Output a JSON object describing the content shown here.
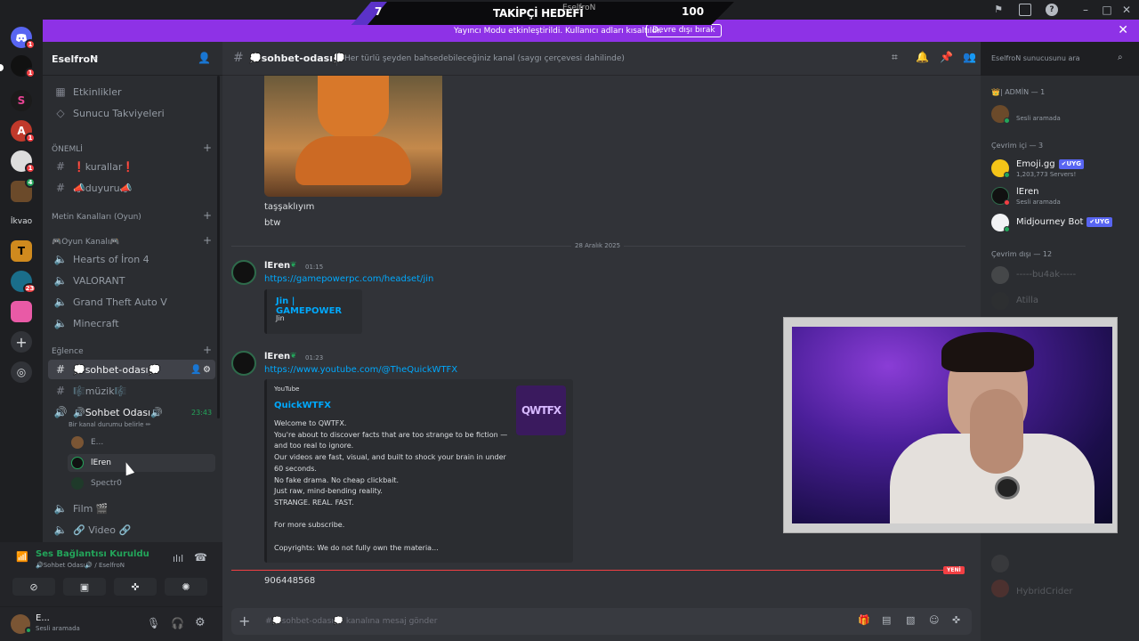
{
  "overlay": {
    "goal_current": "7",
    "goal_title": "TAKİPÇİ HEDEFİ",
    "goal_target": "100",
    "goal_user": "EselfroN"
  },
  "notice": {
    "text": "Yayıncı Modu etkinleştirildi. Kullanıcı adları kısaltıldı.",
    "button": "Devre dışı bırak"
  },
  "rail": {
    "servers": [
      {
        "label": "",
        "badge": "1",
        "color": "#5865f2"
      },
      {
        "label": "",
        "badge": "1",
        "color": "#111111"
      },
      {
        "label": "S",
        "badge": "",
        "color": "#1b1b1b"
      },
      {
        "label": "A",
        "badge": "1",
        "color": "#c0392b"
      },
      {
        "label": "",
        "badge": "1",
        "color": "#dddddd"
      },
      {
        "label": "",
        "badge": "4",
        "color": "#6b4a2a"
      },
      {
        "label": "İkvao",
        "badge": "",
        "color": "#1e1f22"
      },
      {
        "label": "T",
        "badge": "",
        "color": "#d08a1e"
      },
      {
        "label": "",
        "badge": "23",
        "color": "#1a6e8a"
      },
      {
        "label": "",
        "badge": "",
        "color": "#e95aa6"
      }
    ]
  },
  "sidebar": {
    "server_name": "EselfroN",
    "top_items": [
      "Etkinlikler",
      "Sunucu Takviyeleri"
    ],
    "categories": {
      "onemli": "ÖNEMLİ",
      "metin": "Metin Kanalları (Oyun)",
      "oyun": "🎮Oyun Kanalı🎮",
      "eglence": "Eğlence"
    },
    "channels": {
      "kurallar": "❗kurallar❗",
      "duyuru": "📣duyuru📣",
      "hoi": "Hearts of İron 4",
      "valorant": "VALORANT",
      "gta": "Grand Theft Auto V",
      "minecraft": "Minecraft",
      "sohbet": "💭sohbet-odası💭",
      "muzik": "🎼müzik🎼",
      "sohbet_voice": "🔊Sohbet Odası🔊",
      "sohbet_voice_time": "23:43",
      "voice_status": "Bir kanal durumu belirle ✏",
      "film": "Film 🎬",
      "video": "🔗 Video 🔗"
    },
    "voice_users": [
      "E...",
      "lEren",
      "Spectr0"
    ]
  },
  "voice_panel": {
    "status": "Ses Bağlantısı Kuruldu",
    "channel": "🔊Sohbet Odası🔊 / EselfroN"
  },
  "user_panel": {
    "name": "E...",
    "status": "Sesli aramada"
  },
  "chat": {
    "channel": "💭sohbet-odası💭",
    "topic": "Her türlü şeyden bahsedebileceğiniz kanal (saygı çerçevesi dahilinde)",
    "prev_lines": [
      "taşşaklıyım",
      "btw"
    ],
    "date_divider": "28 Aralık 2025",
    "messages": [
      {
        "author": "lEren",
        "time": "01:15",
        "link": "https://gamepowerpc.com/headset/jin",
        "embed_title": "Jin | GAMEPOWER",
        "embed_desc": "Jin"
      },
      {
        "author": "lEren",
        "time": "01:23",
        "link": "https://www.youtube.com/@TheQuickWTFX",
        "embed_provider": "YouTube",
        "embed_title": "QuickWTFX",
        "embed_lines": [
          "Welcome to QWTFX.",
          "You're about to discover facts that are too strange to be fiction —",
          "and too real to ignore.",
          "Our videos are fast, visual, and built to shock your brain in under",
          "60 seconds.",
          "No fake drama. No cheap clickbait.",
          "Just raw, mind-bending reality.",
          "STRANGE. REAL. FAST.",
          "",
          "For more subscribe.",
          "",
          "Copyrights: We do not fully own the materia..."
        ],
        "thumb_text": "QWTFX"
      }
    ],
    "new_label": "YENİ",
    "last_line": "906448568",
    "composer_placeholder": "#💭sohbet-odası💭 kanalına mesaj gönder"
  },
  "search": {
    "placeholder": "EselfroN sunucusunu ara"
  },
  "members": {
    "admin_cat": "👑| ADMİN — 1",
    "admin": [
      {
        "name": "",
        "sub": "Sesli aramada"
      }
    ],
    "online_cat": "Çevrim içi — 3",
    "online": [
      {
        "name": "Emoji.gg",
        "tag": "✔UYG",
        "sub": "1,203,773 Servers!"
      },
      {
        "name": "lEren",
        "tag": "",
        "sub": "Sesli aramada"
      },
      {
        "name": "Midjourney Bot",
        "tag": "✔UYG",
        "sub": ""
      }
    ],
    "offline_cat": "Çevrim dışı — 12",
    "offline": [
      "-----bu4ak-----",
      "Atilla",
      "HybridCrider"
    ]
  },
  "colors": {
    "accent": "#8e32e6",
    "link": "#00a8fc",
    "online": "#23a55a",
    "bot_tag": "#5865f2",
    "new": "#f23f43"
  }
}
